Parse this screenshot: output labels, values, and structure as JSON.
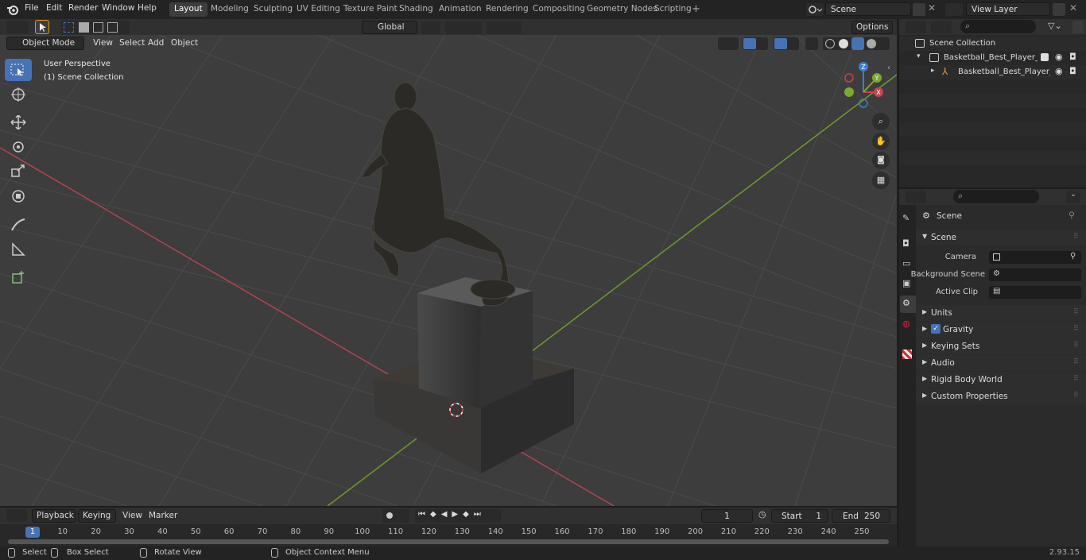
{
  "top_menu": [
    "File",
    "Edit",
    "Render",
    "Window",
    "Help"
  ],
  "workspaces": [
    "Layout",
    "Modeling",
    "Sculpting",
    "UV Editing",
    "Texture Paint",
    "Shading",
    "Animation",
    "Rendering",
    "Compositing",
    "Geometry Nodes",
    "Scripting"
  ],
  "active_workspace": "Layout",
  "scene_name": "Scene",
  "view_layer": "View Layer",
  "viewport_header": {
    "mode": "Object Mode",
    "menus": [
      "View",
      "Select",
      "Add",
      "Object"
    ],
    "transform_orientation": "Global",
    "options": "Options"
  },
  "viewport_overlay": {
    "line1": "User Perspective",
    "line2": "(1) Scene Collection"
  },
  "gizmo_axes": {
    "x": "X",
    "y": "Y",
    "z": "Z"
  },
  "outliner": {
    "root": "Scene Collection",
    "items": [
      "Basketball_Best_Player_Awar",
      "Basketball_Best_Player_A"
    ]
  },
  "properties": {
    "context": "Scene",
    "section": "Scene",
    "fields": [
      {
        "label": "Camera"
      },
      {
        "label": "Background Scene"
      },
      {
        "label": "Active Clip"
      }
    ],
    "panels": [
      "Units",
      "Gravity",
      "Keying Sets",
      "Audio",
      "Rigid Body World",
      "Custom Properties"
    ],
    "gravity_checked": true
  },
  "timeline": {
    "menus": [
      "Playback",
      "Keying",
      "View",
      "Marker"
    ],
    "current_frame": "1",
    "start_label": "Start",
    "start": "1",
    "end_label": "End",
    "end": "250",
    "ticks": [
      "1",
      "10",
      "20",
      "30",
      "40",
      "50",
      "60",
      "70",
      "80",
      "90",
      "100",
      "110",
      "120",
      "130",
      "140",
      "150",
      "160",
      "170",
      "180",
      "190",
      "200",
      "210",
      "220",
      "230",
      "240",
      "250"
    ]
  },
  "statusbar": {
    "items": [
      "Select",
      "Box Select",
      "Rotate View",
      "Object Context Menu"
    ],
    "version": "2.93.15"
  },
  "colors": {
    "accent": "#4772b3",
    "x_axis": "#c8434e",
    "y_axis": "#7ea82f",
    "z_axis": "#3b7fd4",
    "background": "#3d3d3d"
  }
}
